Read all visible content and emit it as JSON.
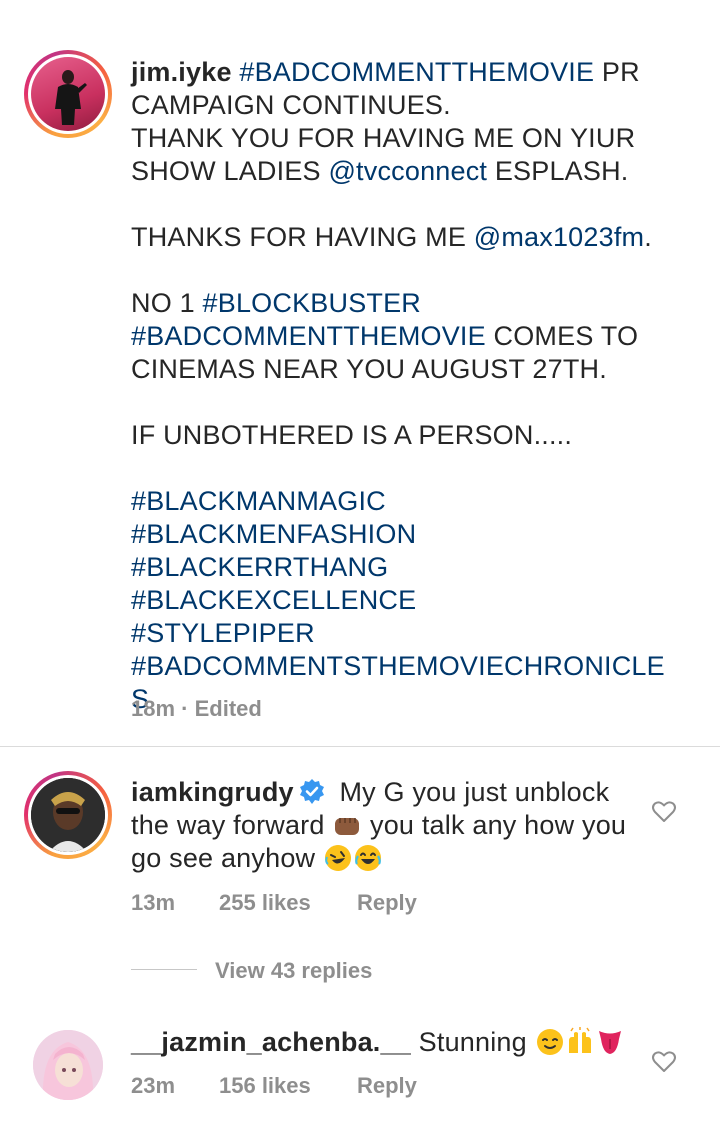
{
  "post": {
    "username": "jim.iyke",
    "caption_segments": [
      {
        "text": " ",
        "type": "text"
      },
      {
        "text": "#BADCOMMENTTHEMOVIE",
        "type": "link"
      },
      {
        "text": " PR CAMPAIGN CONTINUES.\nTHANK YOU FOR HAVING ME ON YIUR SHOW LADIES ",
        "type": "text"
      },
      {
        "text": "@tvcconnect",
        "type": "link"
      },
      {
        "text": " ESPLASH.\n\nTHANKS FOR HAVING ME ",
        "type": "text"
      },
      {
        "text": "@max1023fm",
        "type": "link"
      },
      {
        "text": ".\n\nNO 1 ",
        "type": "text"
      },
      {
        "text": "#BLOCKBUSTER",
        "type": "link"
      },
      {
        "text": "\n",
        "type": "text"
      },
      {
        "text": "#BADCOMMENTTHEMOVIE",
        "type": "link"
      },
      {
        "text": " COMES TO CINEMAS NEAR YOU AUGUST 27TH.\n\nIF UNBOTHERED IS A PERSON.....\n\n",
        "type": "text"
      },
      {
        "text": "#BLACKMANMAGIC",
        "type": "link"
      },
      {
        "text": "\n",
        "type": "text"
      },
      {
        "text": "#BLACKMENFASHION",
        "type": "link"
      },
      {
        "text": "\n",
        "type": "text"
      },
      {
        "text": "#BLACKERRTHANG",
        "type": "link"
      },
      {
        "text": " ",
        "type": "text"
      },
      {
        "text": "#BLACKEXCELLENCE",
        "type": "link"
      },
      {
        "text": "\n",
        "type": "text"
      },
      {
        "text": "#STYLEPIPER",
        "type": "link"
      },
      {
        "text": "\n",
        "type": "text"
      },
      {
        "text": "#BADCOMMENTSTHEMOVIECHRONICLE\nS",
        "type": "link"
      }
    ],
    "time": "18m",
    "separator": "·",
    "edited": "Edited"
  },
  "comments": [
    {
      "username": "iamkingrudy",
      "verified": true,
      "text_1": "My G you just unblock the way forward",
      "text_2": "you talk any how you go see anyhow",
      "time": "13m",
      "likes": "255 likes",
      "reply": "Reply",
      "view_replies": "View 43 replies"
    },
    {
      "username": "__jazmin_achenba.__",
      "text": "Stunning",
      "time": "23m",
      "likes": "156 likes",
      "reply": "Reply"
    }
  ],
  "icons": {
    "heart": "heart-outline-icon",
    "verified": "verified-badge-icon"
  },
  "colors": {
    "link": "#00376b",
    "text": "#262626",
    "meta": "#8e8e8e",
    "verified": "#3897f0"
  }
}
